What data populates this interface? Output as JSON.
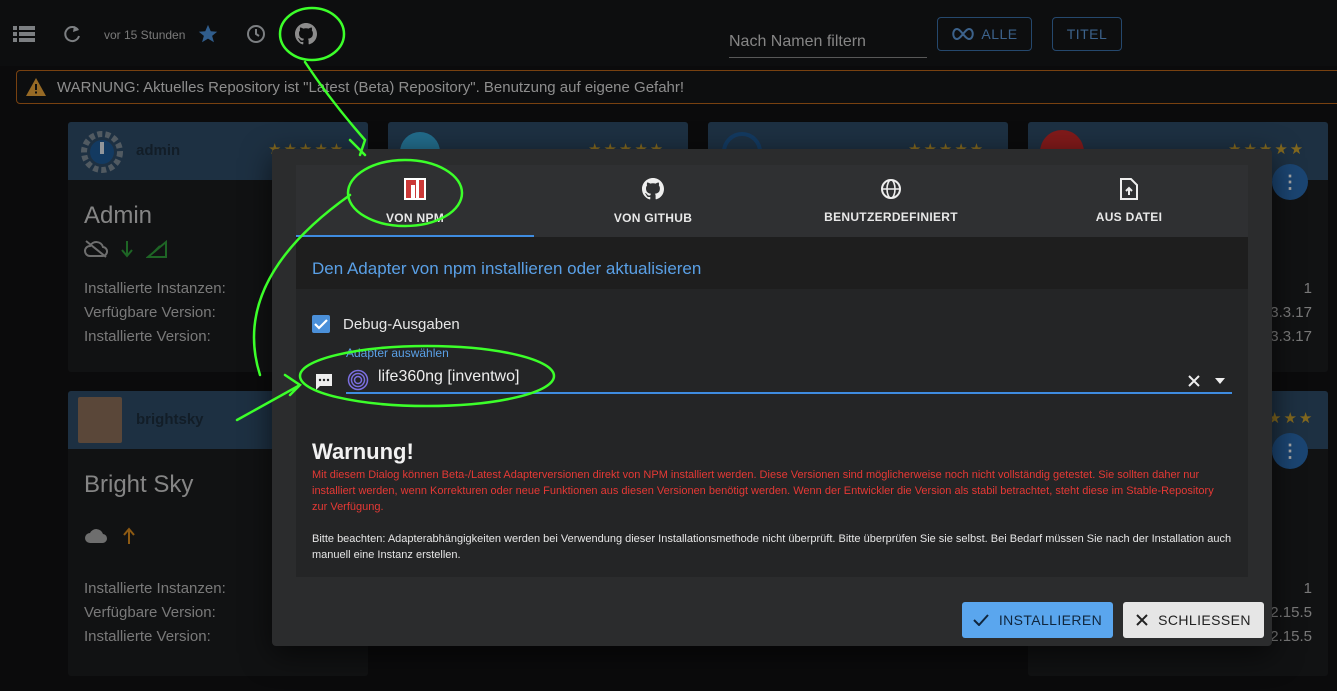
{
  "toolbar": {
    "updated": "vor 15 Stunden",
    "filter_placeholder": "Nach Namen filtern",
    "chip_all": "ALLE",
    "chip_title": "TITEL"
  },
  "banner": {
    "text": "WARNUNG: Aktuelles Repository ist \"Latest (Beta) Repository\". Benutzung auf eigene Gefahr!"
  },
  "cards": {
    "admin": {
      "title": "admin",
      "name": "Admin",
      "installed_instances_label": "Installierte Instanzen:",
      "available_version_label": "Verfügbare Version:",
      "installed_version_label": "Installierte Version:"
    },
    "brightsky": {
      "title": "brightsky",
      "name": "Bright Sky",
      "installed_instances_label": "Installierte Instanzen:",
      "available_version_label": "Verfügbare Version:",
      "installed_version_label": "Installierte Version:"
    },
    "right_top": {
      "instances": "1",
      "available": "3.3.17",
      "installed": "3.3.17"
    },
    "right_bottom": {
      "instances": "1",
      "available": "2.15.5",
      "installed": "2.15.5"
    }
  },
  "dialog": {
    "tabs": [
      {
        "label": "VON NPM",
        "icon": "npm-icon"
      },
      {
        "label": "VON GITHUB",
        "icon": "github-icon"
      },
      {
        "label": "BENUTZERDEFINIERT",
        "icon": "globe-icon"
      },
      {
        "label": "AUS DATEI",
        "icon": "file-upload-icon"
      }
    ],
    "subtitle": "Den Adapter von npm installieren oder aktualisieren",
    "debug_label": "Debug-Ausgaben",
    "select_label": "Adapter auswählen",
    "select_value": "life360ng [inventwo]",
    "warning_title": "Warnung!",
    "warning_text": "Mit diesem Dialog können Beta-/Latest Adapterversionen direkt von NPM installiert werden. Diese Versionen sind möglicherweise noch nicht vollständig getestet. Sie sollten daher nur installiert werden, wenn Korrekturen oder neue Funktionen aus diesen Versionen benötigt werden. Wenn der Entwickler die Version als stabil betrachtet, steht diese im Stable-Repository zur Verfügung.",
    "note_text": "Bitte beachten: Adapterabhängigkeiten werden bei Verwendung dieser Installationsmethode nicht überprüft. Bitte überprüfen Sie sie selbst. Bei Bedarf müssen Sie nach der Installation auch manuell eine Instanz erstellen.",
    "install_button": "INSTALLIEREN",
    "close_button": "SCHLIESSEN"
  },
  "colors": {
    "accent": "#3f8ce0",
    "warning_text": "#e53935",
    "annotation": "#3cff2a",
    "banner_border": "#b8651a"
  }
}
